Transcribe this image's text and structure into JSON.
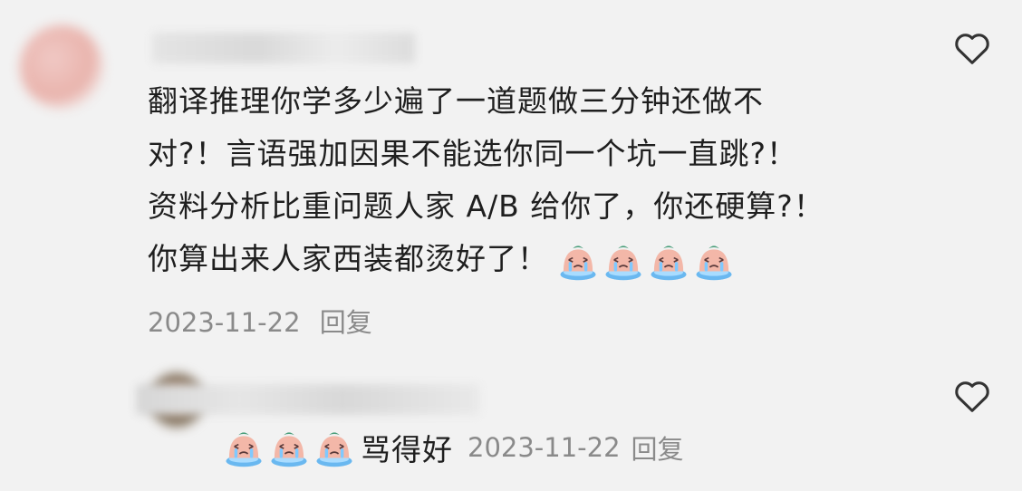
{
  "comments": [
    {
      "lines": [
        "翻译推理你学多少遍了一道题做三分钟还做不",
        "对?！言语强加因果不能选你同一个坑一直跳?！",
        "资料分析比重问题人家 A/B 给你了，你还硬算?！",
        "你算出来人家西装都烫好了！"
      ],
      "emoji_count": 4,
      "date": "2023-11-22",
      "reply_label": "回复"
    },
    {
      "text": "骂得好",
      "emoji_count": 3,
      "date": "2023-11-22",
      "reply_label": "回复"
    }
  ],
  "icons": {
    "like": "heart-outline-icon",
    "emoji": "crying-face-emoji-icon"
  },
  "colors": {
    "background": "#f2f2f2",
    "text": "#1f1f1f",
    "meta": "#8a8a8a",
    "emoji_face": "#f3b7a8",
    "emoji_base": "#6ab8f0"
  }
}
